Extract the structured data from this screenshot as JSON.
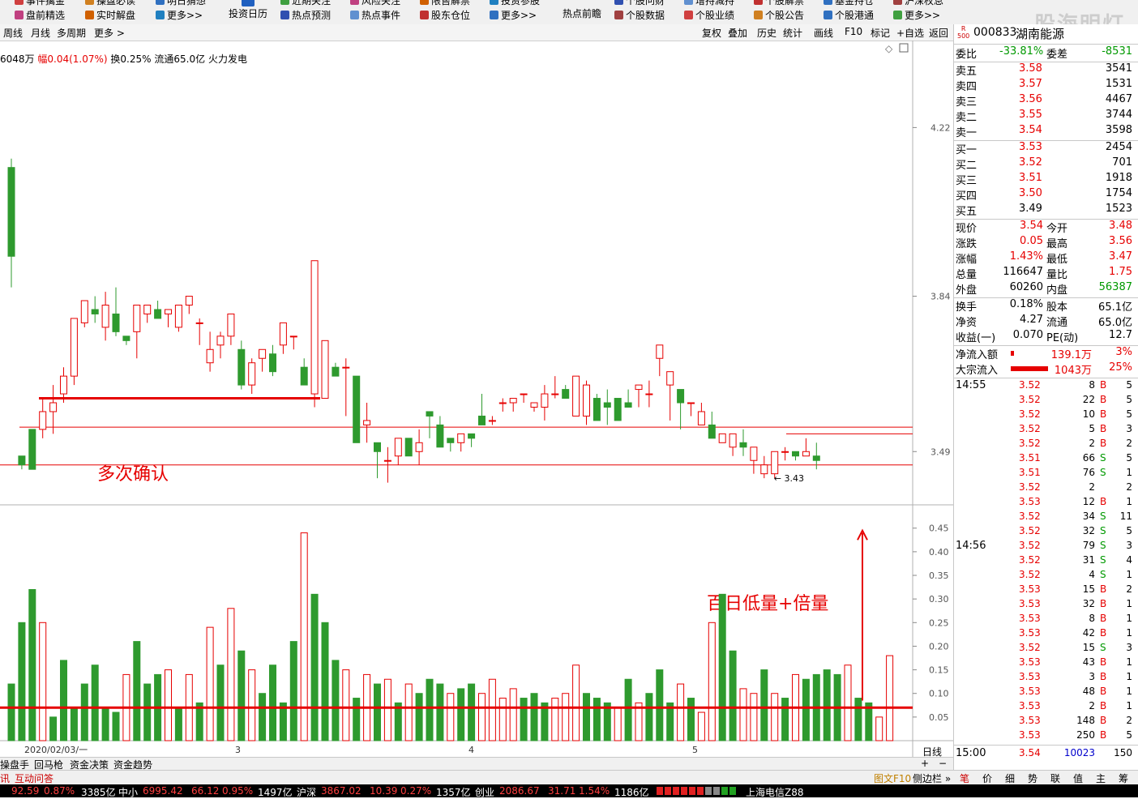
{
  "toolbar": {
    "row1": [
      "事件擒金",
      "操盘必读",
      "明日猜想",
      "近期关注",
      "风险关注",
      "限售解禁",
      "投资参股",
      "个股问财",
      "增持减持",
      "个股解禁",
      "基金持仓",
      "沪深权息"
    ],
    "row2": [
      "盘前精选",
      "实时解盘",
      "更多>>",
      "热点预测",
      "热点事件",
      "股东仓位",
      "更多>>",
      "个股数据",
      "个股业绩",
      "个股公告",
      "个股港通",
      "更多>>"
    ],
    "big1": "投资日历",
    "big2": "热点前瞻",
    "watermark": "股海明灯"
  },
  "period_bar": {
    "left": [
      "周线",
      "月线",
      "多周期",
      "更多 >"
    ],
    "right": [
      "复权",
      "叠加",
      "历史",
      "统计",
      "画线",
      "F10",
      "标记",
      "+自选",
      "返回"
    ]
  },
  "info_line": {
    "vol": "6048万",
    "chg_label": "幅",
    "chg": "0.04(1.07%)",
    "turnover": "换0.25%",
    "float": "流通65.0亿",
    "industry": "火力发电"
  },
  "chart_data": {
    "type": "candlestick",
    "price_axis": {
      "ticks": [
        "4.22",
        "3.84",
        "3.49"
      ],
      "min": 3.37,
      "max": 4.27
    },
    "volume_axis": {
      "ticks": [
        "0.45",
        "0.40",
        "0.35",
        "0.30",
        "0.25",
        "0.20",
        "0.15",
        "0.10",
        "0.05"
      ],
      "max": 0.465
    },
    "x_labels": [
      "2020/02/03/一",
      "3",
      "4",
      "5"
    ],
    "low_label": "3.43",
    "annotations": [
      "多次确认",
      "百日低量+倍量"
    ],
    "candles": [
      [
        4.13,
        4.15,
        3.86,
        3.93
      ],
      [
        3.48,
        3.48,
        3.45,
        3.46
      ],
      [
        3.54,
        3.54,
        3.47,
        3.45
      ],
      [
        3.54,
        3.61,
        3.52,
        3.58
      ],
      [
        3.58,
        3.64,
        3.53,
        3.6
      ],
      [
        3.62,
        3.68,
        3.6,
        3.66
      ],
      [
        3.66,
        3.76,
        3.64,
        3.79
      ],
      [
        3.78,
        3.79,
        3.77,
        3.83
      ],
      [
        3.81,
        3.84,
        3.78,
        3.8
      ],
      [
        3.77,
        3.85,
        3.74,
        3.82
      ],
      [
        3.8,
        3.86,
        3.75,
        3.76
      ],
      [
        3.75,
        3.75,
        3.73,
        3.74
      ],
      [
        3.76,
        3.81,
        3.7,
        3.82
      ],
      [
        3.8,
        3.82,
        3.78,
        3.82
      ],
      [
        3.81,
        3.83,
        3.79,
        3.79
      ],
      [
        3.8,
        3.8,
        3.77,
        3.81
      ],
      [
        3.77,
        3.82,
        3.76,
        3.82
      ],
      [
        3.82,
        3.83,
        3.8,
        3.84
      ],
      [
        3.78,
        3.79,
        3.73,
        3.78
      ],
      [
        3.69,
        3.76,
        3.67,
        3.72
      ],
      [
        3.73,
        3.76,
        3.7,
        3.75
      ],
      [
        3.75,
        3.77,
        3.73,
        3.8
      ],
      [
        3.72,
        3.74,
        3.63,
        3.64
      ],
      [
        3.64,
        3.7,
        3.62,
        3.69
      ],
      [
        3.7,
        3.72,
        3.67,
        3.72
      ],
      [
        3.71,
        3.73,
        3.66,
        3.67
      ],
      [
        3.73,
        3.78,
        3.71,
        3.78
      ],
      [
        3.75,
        3.74,
        3.72,
        3.75
      ],
      [
        3.68,
        3.7,
        3.65,
        3.64
      ],
      [
        3.62,
        3.81,
        3.59,
        3.92
      ],
      [
        3.61,
        3.63,
        3.74,
        3.74
      ],
      [
        3.68,
        3.69,
        3.66,
        3.66
      ],
      [
        3.68,
        3.7,
        3.57,
        3.68
      ],
      [
        3.66,
        3.66,
        3.56,
        3.51
      ],
      [
        3.55,
        3.6,
        3.51,
        3.56
      ],
      [
        3.51,
        3.51,
        3.43,
        3.49
      ],
      [
        3.47,
        3.5,
        3.42,
        3.47
      ],
      [
        3.48,
        3.49,
        3.46,
        3.52
      ],
      [
        3.52,
        3.52,
        3.48,
        3.48
      ],
      [
        3.49,
        3.54,
        3.46,
        3.51
      ],
      [
        3.58,
        3.58,
        3.52,
        3.57
      ],
      [
        3.55,
        3.57,
        3.51,
        3.5
      ],
      [
        3.52,
        3.49,
        3.49,
        3.51
      ],
      [
        3.51,
        3.51,
        3.49,
        3.53
      ],
      [
        3.53,
        3.51,
        3.5,
        3.52
      ],
      [
        3.57,
        3.62,
        3.56,
        3.55
      ],
      [
        3.56,
        3.57,
        3.55,
        3.56
      ],
      [
        3.6,
        3.61,
        3.58,
        3.6
      ],
      [
        3.6,
        3.61,
        3.58,
        3.61
      ],
      [
        3.62,
        3.61,
        3.6,
        3.62
      ],
      [
        3.59,
        3.6,
        3.58,
        3.6
      ],
      [
        3.59,
        3.64,
        3.56,
        3.62
      ],
      [
        3.62,
        3.66,
        3.61,
        3.62
      ],
      [
        3.63,
        3.64,
        3.62,
        3.61
      ],
      [
        3.57,
        3.64,
        3.61,
        3.66
      ],
      [
        3.57,
        3.65,
        3.55,
        3.64
      ],
      [
        3.61,
        3.62,
        3.58,
        3.56
      ],
      [
        3.6,
        3.63,
        3.55,
        3.59
      ],
      [
        3.61,
        3.58,
        3.56,
        3.56
      ],
      [
        3.6,
        3.63,
        3.59,
        3.59
      ],
      [
        3.63,
        3.62,
        3.59,
        3.64
      ],
      [
        3.62,
        3.65,
        3.59,
        3.62
      ],
      [
        3.7,
        3.73,
        3.66,
        3.73
      ],
      [
        3.64,
        3.65,
        3.56,
        3.67
      ],
      [
        3.63,
        3.61,
        3.54,
        3.6
      ],
      [
        3.6,
        3.6,
        3.57,
        3.6
      ],
      [
        3.55,
        3.6,
        3.56,
        3.58
      ],
      [
        3.55,
        3.58,
        3.54,
        3.52
      ],
      [
        3.51,
        3.52,
        3.51,
        3.53
      ],
      [
        3.5,
        3.51,
        3.48,
        3.53
      ],
      [
        3.51,
        3.54,
        3.48,
        3.5
      ],
      [
        3.47,
        3.48,
        3.44,
        3.5
      ],
      [
        3.44,
        3.48,
        3.43,
        3.46
      ],
      [
        3.44,
        3.46,
        3.43,
        3.49
      ],
      [
        3.49,
        3.5,
        3.47,
        3.49
      ],
      [
        3.49,
        3.49,
        3.47,
        3.48
      ],
      [
        3.48,
        3.52,
        3.48,
        3.49
      ],
      [
        3.48,
        3.51,
        3.45,
        3.47
      ]
    ],
    "volumes": [
      [
        0.12,
        0
      ],
      [
        0.25,
        0
      ],
      [
        0.32,
        0
      ],
      [
        0.25,
        1
      ],
      [
        0.05,
        0
      ],
      [
        0.17,
        0
      ],
      [
        0.07,
        0
      ],
      [
        0.12,
        0
      ],
      [
        0.16,
        0
      ],
      [
        0.07,
        0
      ],
      [
        0.06,
        0
      ],
      [
        0.14,
        1
      ],
      [
        0.21,
        0
      ],
      [
        0.12,
        0
      ],
      [
        0.14,
        0
      ],
      [
        0.15,
        1
      ],
      [
        0.07,
        0
      ],
      [
        0.14,
        1
      ],
      [
        0.08,
        0
      ],
      [
        0.24,
        1
      ],
      [
        0.16,
        0
      ],
      [
        0.28,
        1
      ],
      [
        0.19,
        0
      ],
      [
        0.15,
        1
      ],
      [
        0.1,
        0
      ],
      [
        0.16,
        0
      ],
      [
        0.08,
        0
      ],
      [
        0.21,
        0
      ],
      [
        0.44,
        1
      ],
      [
        0.31,
        0
      ],
      [
        0.25,
        0
      ],
      [
        0.17,
        0
      ],
      [
        0.15,
        1
      ],
      [
        0.09,
        0
      ],
      [
        0.14,
        1
      ],
      [
        0.12,
        0
      ],
      [
        0.13,
        1
      ],
      [
        0.08,
        0
      ],
      [
        0.12,
        1
      ],
      [
        0.1,
        0
      ],
      [
        0.13,
        0
      ],
      [
        0.12,
        0
      ],
      [
        0.1,
        1
      ],
      [
        0.11,
        0
      ],
      [
        0.12,
        0
      ],
      [
        0.1,
        1
      ],
      [
        0.13,
        1
      ],
      [
        0.09,
        1
      ],
      [
        0.11,
        1
      ],
      [
        0.09,
        0
      ],
      [
        0.1,
        0
      ],
      [
        0.08,
        0
      ],
      [
        0.09,
        1
      ],
      [
        0.1,
        1
      ],
      [
        0.16,
        1
      ],
      [
        0.1,
        0
      ],
      [
        0.09,
        0
      ],
      [
        0.08,
        0
      ],
      [
        0.07,
        1
      ],
      [
        0.13,
        0
      ],
      [
        0.08,
        1
      ],
      [
        0.1,
        0
      ],
      [
        0.15,
        0
      ],
      [
        0.08,
        0
      ],
      [
        0.12,
        1
      ],
      [
        0.09,
        0
      ],
      [
        0.06,
        1
      ],
      [
        0.25,
        1
      ],
      [
        0.31,
        0
      ],
      [
        0.19,
        0
      ],
      [
        0.11,
        1
      ],
      [
        0.1,
        1
      ],
      [
        0.15,
        0
      ],
      [
        0.1,
        1
      ],
      [
        0.09,
        0
      ],
      [
        0.14,
        1
      ],
      [
        0.13,
        0
      ],
      [
        0.14,
        0
      ],
      [
        0.15,
        0
      ],
      [
        0.14,
        0
      ],
      [
        0.16,
        1
      ],
      [
        0.09,
        0
      ],
      [
        0.08,
        0
      ],
      [
        0.05,
        1
      ],
      [
        0.18,
        1
      ]
    ]
  },
  "stock": {
    "code": "000833",
    "name": "湖南能源",
    "badge_top": "R",
    "badge_bottom": "500"
  },
  "quote": {
    "weibi_label": "委比",
    "weibi": "-33.81%",
    "weicha_label": "委差",
    "weicha": "-8531",
    "asks": [
      {
        "label": "卖五",
        "price": "3.58",
        "vol": "3541"
      },
      {
        "label": "卖四",
        "price": "3.57",
        "vol": "1531"
      },
      {
        "label": "卖三",
        "price": "3.56",
        "vol": "4467"
      },
      {
        "label": "卖二",
        "price": "3.55",
        "vol": "3744"
      },
      {
        "label": "卖一",
        "price": "3.54",
        "vol": "3598"
      }
    ],
    "bids": [
      {
        "label": "买一",
        "price": "3.53",
        "vol": "2454"
      },
      {
        "label": "买二",
        "price": "3.52",
        "vol": "701"
      },
      {
        "label": "买三",
        "price": "3.51",
        "vol": "1918"
      },
      {
        "label": "买四",
        "price": "3.50",
        "vol": "1754"
      },
      {
        "label": "买五",
        "price": "3.49",
        "vol": "1523"
      }
    ],
    "stats1": [
      {
        "l1": "现价",
        "v1": "3.54",
        "l2": "今开",
        "v2": "3.48"
      },
      {
        "l1": "涨跌",
        "v1": "0.05",
        "l2": "最高",
        "v2": "3.56"
      },
      {
        "l1": "涨幅",
        "v1": "1.43%",
        "l2": "最低",
        "v2": "3.47"
      },
      {
        "l1": "总量",
        "v1": "116647",
        "l2": "量比",
        "v2": "1.75"
      },
      {
        "l1": "外盘",
        "v1": "60260",
        "l2": "内盘",
        "v2": "56387"
      }
    ],
    "stats2": [
      {
        "l1": "换手",
        "v1": "0.18%",
        "l2": "股本",
        "v2": "65.1亿"
      },
      {
        "l1": "净资",
        "v1": "4.27",
        "l2": "流通",
        "v2": "65.0亿"
      },
      {
        "l1": "收益(一)",
        "v1": "0.070",
        "l2": "PE(动)",
        "v2": "12.7"
      }
    ],
    "flow": [
      {
        "label": "净流入额",
        "value": "139.1万",
        "pct": "3%"
      },
      {
        "label": "大宗流入",
        "value": "1043万",
        "pct": "25%"
      }
    ]
  },
  "ticks": [
    {
      "time": "14:55",
      "price": "3.52",
      "vol": "8",
      "bs": "B",
      "n": "5"
    },
    {
      "time": "",
      "price": "3.52",
      "vol": "22",
      "bs": "B",
      "n": "5"
    },
    {
      "time": "",
      "price": "3.52",
      "vol": "10",
      "bs": "B",
      "n": "5"
    },
    {
      "time": "",
      "price": "3.52",
      "vol": "5",
      "bs": "B",
      "n": "3"
    },
    {
      "time": "",
      "price": "3.52",
      "vol": "2",
      "bs": "B",
      "n": "2"
    },
    {
      "time": "",
      "price": "3.51",
      "vol": "66",
      "bs": "S",
      "n": "5"
    },
    {
      "time": "",
      "price": "3.51",
      "vol": "76",
      "bs": "S",
      "n": "1"
    },
    {
      "time": "",
      "price": "3.52",
      "vol": "2",
      "bs": "",
      "n": "2"
    },
    {
      "time": "",
      "price": "3.53",
      "vol": "12",
      "bs": "B",
      "n": "1"
    },
    {
      "time": "",
      "price": "3.52",
      "vol": "34",
      "bs": "S",
      "n": "11"
    },
    {
      "time": "",
      "price": "3.52",
      "vol": "32",
      "bs": "S",
      "n": "5"
    },
    {
      "time": "14:56",
      "price": "3.52",
      "vol": "79",
      "bs": "S",
      "n": "3"
    },
    {
      "time": "",
      "price": "3.52",
      "vol": "31",
      "bs": "S",
      "n": "4"
    },
    {
      "time": "",
      "price": "3.52",
      "vol": "4",
      "bs": "S",
      "n": "1"
    },
    {
      "time": "",
      "price": "3.53",
      "vol": "15",
      "bs": "B",
      "n": "2"
    },
    {
      "time": "",
      "price": "3.53",
      "vol": "32",
      "bs": "B",
      "n": "1"
    },
    {
      "time": "",
      "price": "3.53",
      "vol": "8",
      "bs": "B",
      "n": "1"
    },
    {
      "time": "",
      "price": "3.53",
      "vol": "42",
      "bs": "B",
      "n": "1"
    },
    {
      "time": "",
      "price": "3.52",
      "vol": "15",
      "bs": "S",
      "n": "3"
    },
    {
      "time": "",
      "price": "3.53",
      "vol": "43",
      "bs": "B",
      "n": "1"
    },
    {
      "time": "",
      "price": "3.53",
      "vol": "3",
      "bs": "B",
      "n": "1"
    },
    {
      "time": "",
      "price": "3.53",
      "vol": "48",
      "bs": "B",
      "n": "1"
    },
    {
      "time": "",
      "price": "3.53",
      "vol": "2",
      "bs": "B",
      "n": "1"
    },
    {
      "time": "",
      "price": "3.53",
      "vol": "148",
      "bs": "B",
      "n": "2"
    },
    {
      "time": "",
      "price": "3.53",
      "vol": "250",
      "bs": "B",
      "n": "5"
    }
  ],
  "last_tick": {
    "time": "15:00",
    "price": "3.54",
    "vol": "10023",
    "n": "150"
  },
  "bottom_tabs": [
    "操盘手",
    "回马枪",
    "资金决策",
    "资金趋势"
  ],
  "bottom_tabs2": [
    "讯",
    "互动问答"
  ],
  "right_bottom": {
    "daily": "日线",
    "plus": "+",
    "minus": "−",
    "links": [
      "图文F10",
      "侧边栏 »"
    ]
  },
  "right_tabs": [
    "笔",
    "价",
    "细",
    "势",
    "联",
    "值",
    "主",
    "筹"
  ],
  "status": {
    "items": [
      {
        "v1": "92.59",
        "v2": "0.87%",
        "v3": "3385亿"
      },
      {
        "name": "中小",
        "v1": "6995.42",
        "v2": "66.12",
        "v3": "0.95%",
        "v4": "1497亿"
      },
      {
        "name": "沪深",
        "v1": "3867.02",
        "v2": "10.39",
        "v3": "0.27%",
        "v4": "1357亿"
      },
      {
        "name": "创业",
        "v1": "2086.67",
        "v2": "31.71",
        "v3": "1.54%",
        "v4": "1186亿"
      }
    ],
    "server": "上海电信Z88"
  }
}
